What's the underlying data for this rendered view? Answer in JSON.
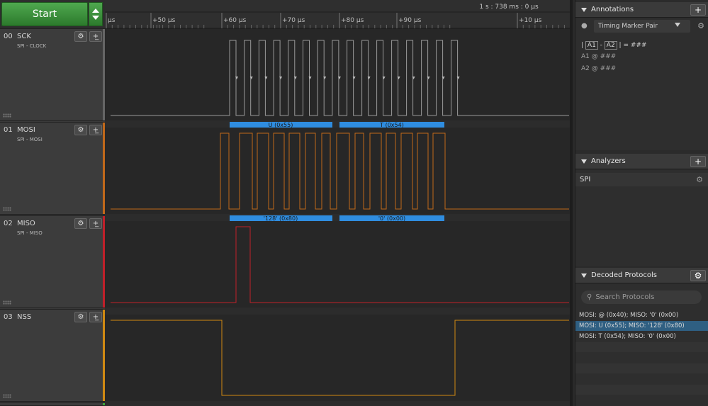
{
  "app": {
    "start_label": "Start"
  },
  "timeline": {
    "header_time": "1 s : 738 ms : 0 µs",
    "ticks": [
      "µs",
      "+50 µs",
      "+60 µs",
      "+70 µs",
      "+80 µs",
      "+90 µs",
      "+10 µs"
    ]
  },
  "channels": [
    {
      "num": "00",
      "name": "SCK",
      "sub": "SPI - CLOCK",
      "color": "#888888"
    },
    {
      "num": "01",
      "name": "MOSI",
      "sub": "SPI - MOSI",
      "color": "#c0681a"
    },
    {
      "num": "02",
      "name": "MISO",
      "sub": "SPI - MISO",
      "color": "#c0202a"
    },
    {
      "num": "03",
      "name": "NSS",
      "sub": "",
      "color": "#d08a12"
    }
  ],
  "decode_labels": {
    "mosi": [
      "U (0x55)",
      "T (0x54)"
    ],
    "miso": [
      "'128' (0x80)",
      "'0' (0x00)"
    ]
  },
  "annotations": {
    "title": "Annotations",
    "marker_pair": "Timing Marker Pair",
    "line1_a1": "A1",
    "line1_a2": "A2",
    "line1_value": "= ###",
    "line2": "A1  @  ###",
    "line3": "A2  @  ###"
  },
  "analyzers": {
    "title": "Analyzers",
    "items": [
      "SPI"
    ]
  },
  "decoded": {
    "title": "Decoded Protocols",
    "search_placeholder": "Search Protocols",
    "rows": [
      "MOSI: @ (0x40);  MISO: '0' (0x00)",
      "MOSI: U (0x55);  MISO: '128' (0x80)",
      "MOSI: T (0x54);  MISO: '0' (0x00)"
    ],
    "selected_index": 1
  },
  "colors": {
    "accent_green": "#2c7a2c",
    "decode_blue": "#2f8de0",
    "selected_row": "#2f5f82",
    "sck_trace": "#9a9a9a",
    "mosi_trace": "#c0681a",
    "miso_trace": "#c0202a",
    "nss_trace": "#d08a12"
  },
  "icons": {
    "settings": "gear-icon",
    "add": "plus-icon",
    "trigger": "trigger-edge-icon",
    "collapse": "triangle-down-icon",
    "search": "search-icon",
    "pin": "pin-icon"
  }
}
